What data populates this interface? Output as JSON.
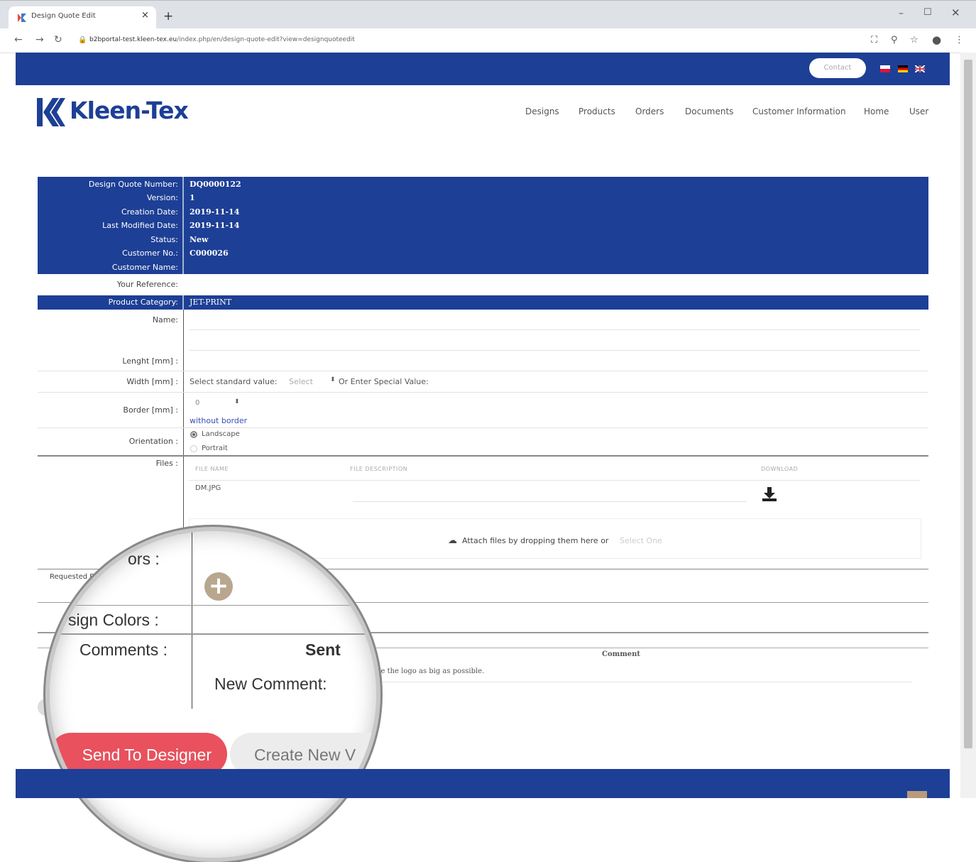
{
  "browser": {
    "tab_title": "Design Quote Edit",
    "tab_close": "×",
    "new_tab": "+",
    "url_host": "b2bportal-test.kleen-tex.eu",
    "url_path": "/index.php/en/design-quote-edit?view=designquoteedit",
    "icons": [
      "back-icon",
      "forward-icon",
      "reload-icon",
      "lock-icon",
      "translate-icon",
      "zoom-icon",
      "star-icon",
      "account-icon",
      "menu-icon"
    ]
  },
  "topbar": {
    "contact_label": "Contact",
    "colors": {
      "bar": "#1d3f95"
    }
  },
  "brand": {
    "logo_text": "Kleen-Tex"
  },
  "nav": {
    "items": [
      "Designs",
      "Products",
      "Orders",
      "Documents",
      "Customer Information",
      "Home",
      "User"
    ]
  },
  "quote": {
    "rows": [
      {
        "label": "Design Quote Number:",
        "value": "DQ0000122"
      },
      {
        "label": "Version:",
        "value": "1"
      },
      {
        "label": "Creation Date:",
        "value": "2019-11-14"
      },
      {
        "label": "Last Modified Date:",
        "value": "2019-11-14"
      },
      {
        "label": "Status:",
        "value": "New"
      },
      {
        "label": "Customer No.:",
        "value": "C000026"
      },
      {
        "label": "Customer Name:",
        "value": ""
      }
    ],
    "your_reference_label": "Your Reference:",
    "product_category_label": "Product Category:",
    "product_category_value": "JET-PRINT",
    "name_label": "Name:",
    "length_label": "Lenght [mm] :",
    "width_label": "Width [mm] :",
    "width_select_label": "Select standard value:",
    "width_select_value": "Select",
    "width_or_label": "Or Enter Special Value:",
    "border_label": "Border [mm] :",
    "border_value": "0",
    "without_border": "without border",
    "orientation_label": "Orientation :",
    "orientation_options": [
      "Landscape",
      "Portrait"
    ],
    "files_label": "Files :",
    "files_headers": [
      "FILE NAME",
      "FILE DESCRIPTION",
      "DOWNLOAD"
    ],
    "file_name": "DM.JPG",
    "attach_text": "Attach files by dropping them here or",
    "attach_link": "Select One",
    "requested_label": "Requested B",
    "comment_header": "Comment",
    "comment_text": "make the logo as big as possible."
  },
  "magnifier": {
    "colors_partial": "ors :",
    "design_colors": "sign Colors :",
    "comments": "Comments :",
    "sent": "Sent",
    "new_comment": "New Comment:",
    "send_button": "Send To Designer",
    "create_button": "Create New V",
    "colors": {
      "send": "#e8515d",
      "plus": "#b8a68e"
    }
  }
}
